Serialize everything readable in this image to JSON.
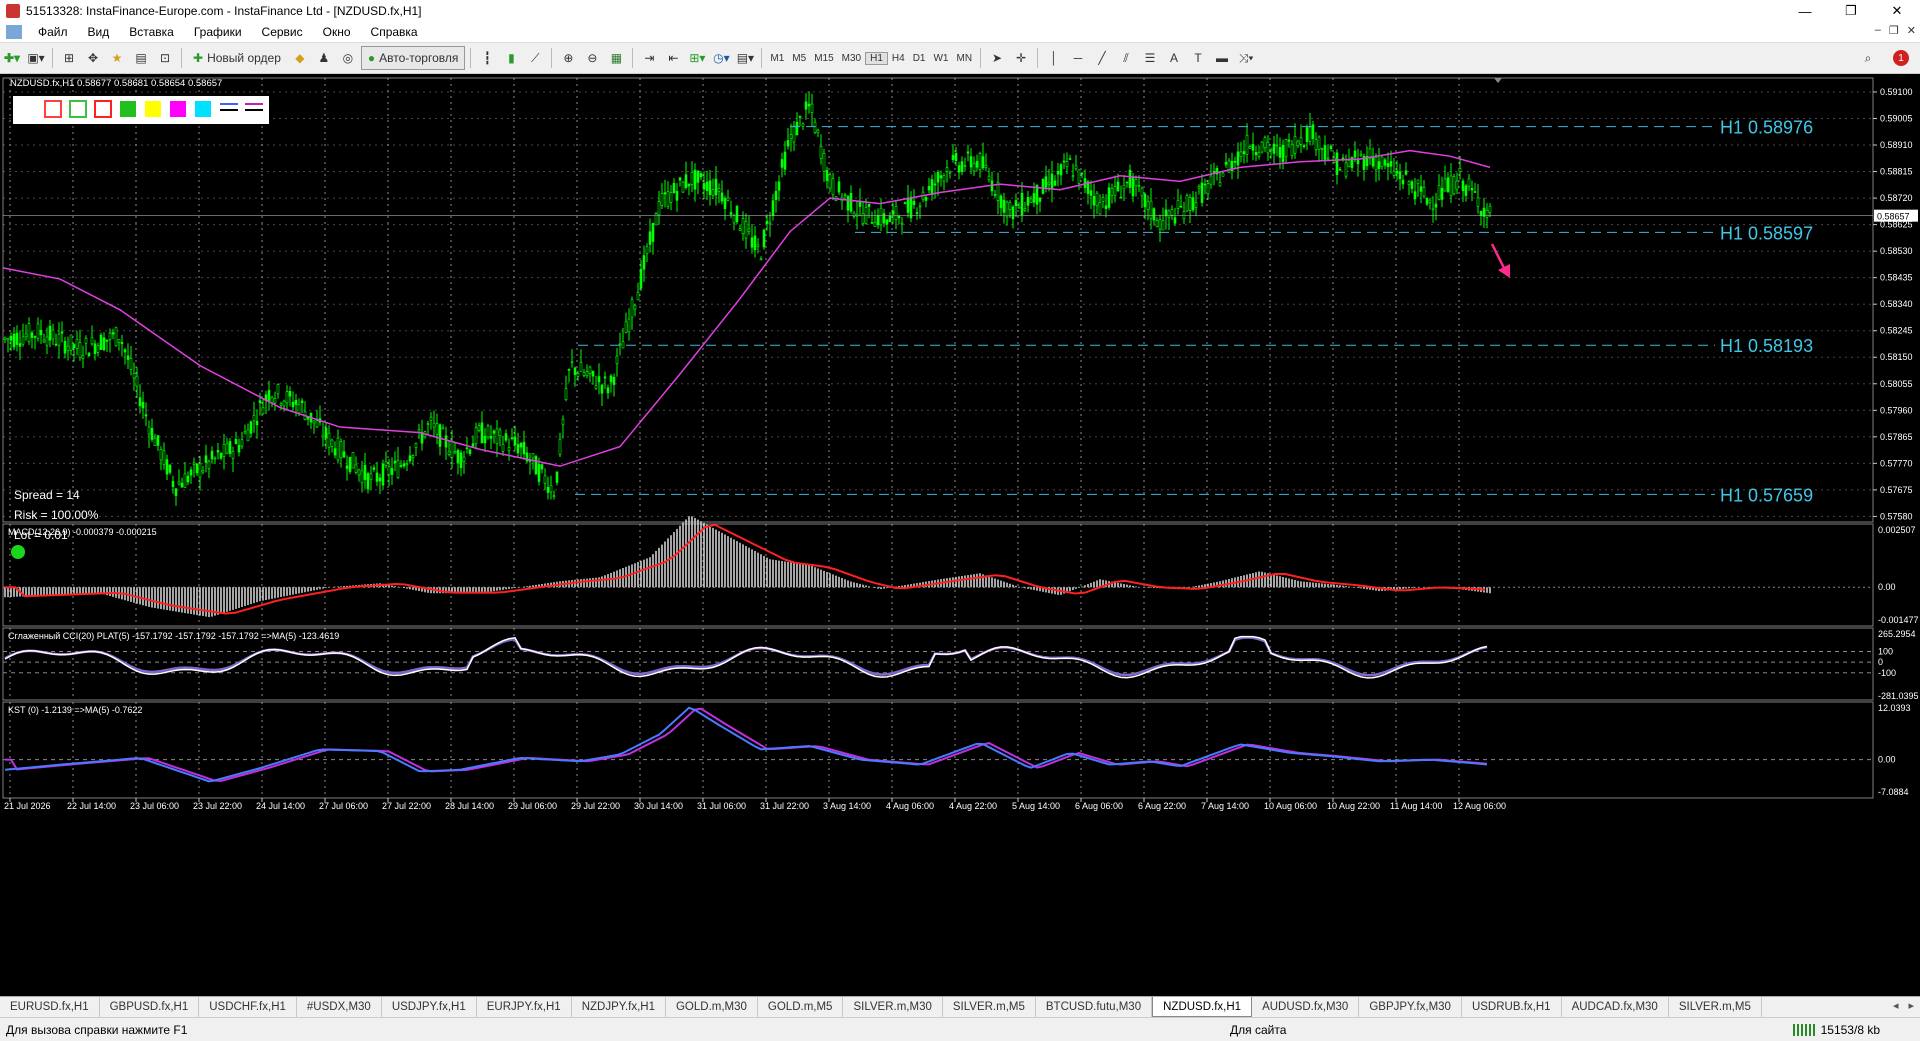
{
  "window": {
    "title": "51513328: InstaFinance-Europe.com - InstaFinance Ltd - [NZDUSD.fx,H1]",
    "min": "—",
    "max": "❐",
    "close": "✕"
  },
  "menu": [
    "Файл",
    "Вид",
    "Вставка",
    "Графики",
    "Сервис",
    "Окно",
    "Справка"
  ],
  "toolbar": {
    "new_order": "Новый ордер",
    "auto_trading": "Авто-торговля",
    "timeframes": [
      "M1",
      "M5",
      "M15",
      "M30",
      "H1",
      "H4",
      "D1",
      "W1",
      "MN"
    ],
    "active_timeframe": "H1"
  },
  "chart": {
    "header": "NZDUSD.fx,H1  0.58677 0.58681 0.58654 0.58657",
    "current_price": "0.58657",
    "info": [
      "Spread = 14",
      "Risk = 100.00%",
      "Lot = 0.01"
    ],
    "levels": [
      {
        "label": "H1 0.58976",
        "price": 0.58976
      },
      {
        "label": "H1 0.58597",
        "price": 0.58597
      },
      {
        "label": "H1 0.58193",
        "price": 0.58193
      },
      {
        "label": "H1 0.57659",
        "price": 0.57659
      }
    ],
    "price_axis": [
      "0.59100",
      "0.59005",
      "0.58910",
      "0.58815",
      "0.58720",
      "0.58625",
      "0.58530",
      "0.58435",
      "0.58340",
      "0.58245",
      "0.58150",
      "0.58055",
      "0.57960",
      "0.57865",
      "0.57770",
      "0.57675",
      "0.57580"
    ],
    "price_range": [
      0.5756,
      0.5915
    ],
    "colors": {
      "candles": "#00ff00",
      "ma": "#e040e0",
      "level_line": "#3fb7d8",
      "level_text": "#3fc8e8",
      "arrow": "#ff2a8a",
      "grid": "#c8c8c8"
    },
    "swatches": [
      "#ffffff",
      "#ff4040",
      "#40c040",
      "#ff2020",
      "#20c020",
      "#ffff00",
      "#ff00ff",
      "#00e0ff",
      "#4060ff",
      "#c020c0"
    ]
  },
  "macd": {
    "label": "MACD(12,26,9) -0.000379 -0.000215",
    "axis": [
      "0.002507",
      "0.00",
      "-0.001477"
    ]
  },
  "cci": {
    "label": "Сглаженный CCI(20) PLAT(5) -157.1792 -157.1792 -157.1792  =>MA(5) -123.4619",
    "axis": [
      "265.2954",
      "100",
      "0",
      "-100",
      "-281.0395"
    ]
  },
  "kst": {
    "label": "KST (0) -1.2139  =>MA(5) -0.7622",
    "axis": [
      "12.0393",
      "0.00",
      "-7.0884"
    ]
  },
  "time_axis": [
    "21 Jul 2026",
    "22 Jul 14:00",
    "23 Jul 06:00",
    "23 Jul 22:00",
    "24 Jul 14:00",
    "27 Jul 06:00",
    "27 Jul 22:00",
    "28 Jul 14:00",
    "29 Jul 06:00",
    "29 Jul 22:00",
    "30 Jul 14:00",
    "31 Jul 06:00",
    "31 Jul 22:00",
    "3 Aug 14:00",
    "4 Aug 06:00",
    "4 Aug 22:00",
    "5 Aug 14:00",
    "6 Aug 06:00",
    "6 Aug 22:00",
    "7 Aug 14:00",
    "10 Aug 06:00",
    "10 Aug 22:00",
    "11 Aug 14:00",
    "12 Aug 06:00"
  ],
  "tabs": [
    "EURUSD.fx,H1",
    "GBPUSD.fx,H1",
    "USDCHF.fx,H1",
    "#USDX,M30",
    "USDJPY.fx,H1",
    "EURJPY.fx,H1",
    "NZDJPY.fx,H1",
    "GOLD.m,M30",
    "GOLD.m,M5",
    "SILVER.m,M30",
    "SILVER.m,M5",
    "BTCUSD.futu,M30",
    "NZDUSD.fx,H1",
    "AUDUSD.fx,M30",
    "GBPJPY.fx,M30",
    "USDRUB.fx,H1",
    "AUDCAD.fx,M30",
    "SILVER.m,M5"
  ],
  "active_tab": "NZDUSD.fx,H1",
  "status": {
    "help": "Для вызова справки нажмите F1",
    "profile": "Для сайта",
    "traffic": "15153/8 kb"
  }
}
